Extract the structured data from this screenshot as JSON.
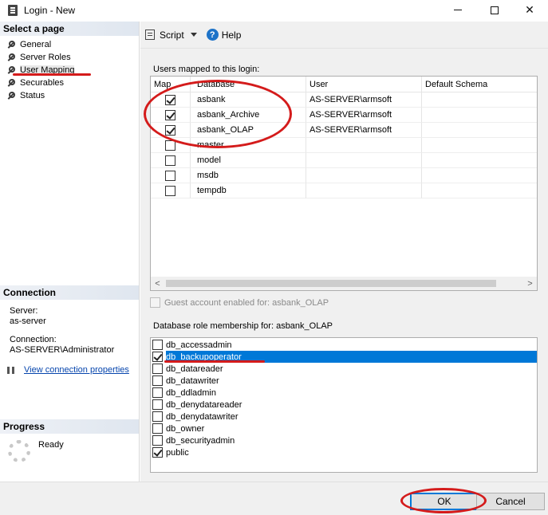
{
  "window": {
    "title": "Login - New",
    "minimize_glyph": "",
    "maximize_glyph": "",
    "close_glyph": "✕"
  },
  "left_pane": {
    "select_page_header": "Select a page",
    "pages": [
      {
        "label": "General",
        "icon": "wrench-icon"
      },
      {
        "label": "Server Roles",
        "icon": "wrench-icon"
      },
      {
        "label": "User Mapping",
        "icon": "wrench-icon",
        "active": true
      },
      {
        "label": "Securables",
        "icon": "wrench-icon"
      },
      {
        "label": "Status",
        "icon": "wrench-icon"
      }
    ],
    "connection_header": "Connection",
    "server_label": "Server:",
    "server_value": "as-server",
    "connection_label": "Connection:",
    "connection_value": "AS-SERVER\\Administrator",
    "view_connection_link": "View connection properties",
    "progress_header": "Progress",
    "progress_status": "Ready"
  },
  "toolbar": {
    "script_label": "Script",
    "help_label": "Help",
    "help_glyph": "?"
  },
  "mapping": {
    "group_label": "Users mapped to this login:",
    "columns": [
      "Map",
      "Database",
      "User",
      "Default Schema"
    ],
    "rows": [
      {
        "checked": true,
        "database": "asbank",
        "user": "AS-SERVER\\armsoft",
        "schema": ""
      },
      {
        "checked": true,
        "database": "asbank_Archive",
        "user": "AS-SERVER\\armsoft",
        "schema": ""
      },
      {
        "checked": true,
        "database": "asbank_OLAP",
        "user": "AS-SERVER\\armsoft",
        "schema": ""
      },
      {
        "checked": false,
        "database": "master",
        "user": "",
        "schema": ""
      },
      {
        "checked": false,
        "database": "model",
        "user": "",
        "schema": ""
      },
      {
        "checked": false,
        "database": "msdb",
        "user": "",
        "schema": ""
      },
      {
        "checked": false,
        "database": "tempdb",
        "user": "",
        "schema": ""
      }
    ],
    "scroll_left_glyph": "<",
    "scroll_right_glyph": ">"
  },
  "guest": {
    "label": "Guest account enabled for: asbank_OLAP",
    "checked": false
  },
  "roles": {
    "group_label": "Database role membership for: asbank_OLAP",
    "items": [
      {
        "label": "db_accessadmin",
        "checked": false
      },
      {
        "label": "db_backupoperator",
        "checked": true,
        "selected": true
      },
      {
        "label": "db_datareader",
        "checked": false
      },
      {
        "label": "db_datawriter",
        "checked": false
      },
      {
        "label": "db_ddladmin",
        "checked": false
      },
      {
        "label": "db_denydatareader",
        "checked": false
      },
      {
        "label": "db_denydatawriter",
        "checked": false
      },
      {
        "label": "db_owner",
        "checked": false
      },
      {
        "label": "db_securityadmin",
        "checked": false
      },
      {
        "label": "public",
        "checked": true
      }
    ]
  },
  "buttons": {
    "ok": "OK",
    "cancel": "Cancel"
  },
  "colors": {
    "selection": "#0078d7",
    "annotation": "#d41b1b",
    "link": "#0645ad"
  }
}
